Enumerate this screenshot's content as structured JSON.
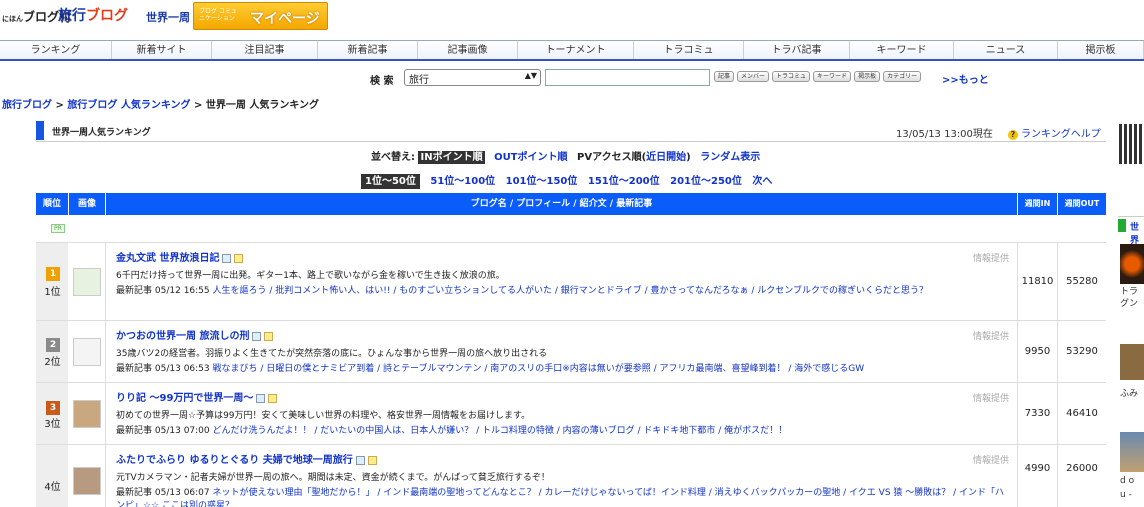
{
  "header": {
    "logo_mura": "ブログ村",
    "logo_mura_small": "にほん",
    "logo_travel_a": "旅行",
    "logo_travel_b": "ブログ",
    "logo_world": "世界一周",
    "mypage_sub": "ブログ コミュニケーション",
    "mypage_label": "マイページ"
  },
  "nav": {
    "items": [
      "ランキング",
      "新着サイト",
      "注目記事",
      "新着記事",
      "記事画像",
      "トーナメント",
      "トラコミュ",
      "トラバ記事",
      "キーワード",
      "ニュース",
      "掲示板"
    ]
  },
  "search": {
    "label": "検 索",
    "select_value": "旅行",
    "buttons": [
      "記事",
      "メンバー",
      "トラコミュ",
      "キーワード",
      "掲示板",
      "カテゴリー"
    ],
    "more": ">>もっと"
  },
  "breadcrumb": {
    "a": "旅行ブログ",
    "sep1": " > ",
    "b": "旅行ブログ 人気ランキング",
    "sep2": " > ",
    "c": "世界一周 人気ランキング"
  },
  "ranking": {
    "title": "世界一周人気ランキング",
    "datetime": "13/05/13 13:00現在",
    "help": "ランキングヘルプ",
    "sort_label": "並べ替え:",
    "sort_selected": "INポイント順",
    "sort_out": "OUTポイント順",
    "sort_pv": "PVアクセス順(",
    "sort_pv_link": "近日開始",
    "sort_pv_end": ")",
    "sort_random": "ランダム表示",
    "pages": [
      "1位〜50位",
      "51位〜100位",
      "101位〜150位",
      "151位〜200位",
      "201位〜250位",
      "次へ"
    ],
    "col_rank": "順位",
    "col_img": "画像",
    "col_main": "ブログ名 / プロフィール  / 紹介文 / 最新記事",
    "col_in": "週間IN",
    "col_out": "週間OUT",
    "pr": "PR",
    "info_label": "情報提供",
    "latest_label": "最新記事",
    "rows": [
      {
        "rank": "1位",
        "medal": "1",
        "medal_color": "#f0a000",
        "name": "金丸文武 世界放浪日記",
        "desc": "6千円だけ持って世界一周に出発。ギター1本、路上で歌いながら金を稼いで生き抜く放浪の旅。",
        "date": "05/12 16:55",
        "news": "人生を謳ろう / 批判コメント怖い人、はい!! / ものすごい立ちションしてる人がいた / 銀行マンとドライブ / 豊かさってなんだろなぁ / ルクセンブルクでの稼ぎいくらだと思う？",
        "in": "11810",
        "out": "55280"
      },
      {
        "rank": "2位",
        "medal": "2",
        "medal_color": "#8a8a8a",
        "name": "かつおの世界一周 旅流しの刑",
        "desc": "35歳バツ2の経営者。羽振りよく生きてたが突然奈落の底に。ひょんな事から世界一周の旅へ放り出される",
        "date": "05/13 06:53",
        "news": "戦なまびち / 日曜日の僕とナミビア到着 / 詩とテーブルマウンテン / 南アのスリの手口※内容は無いが要参照 / アフリカ最南端、喜望峰到着！ / 海外で感じるGW",
        "in": "9950",
        "out": "53290"
      },
      {
        "rank": "3位",
        "medal": "3",
        "medal_color": "#c85a1a",
        "name": "りり記 〜99万円で世界一周〜",
        "desc": "初めての世界一周☆予算は99万円！安くて美味しい世界の料理や、格安世界一周情報をお届けします。",
        "date": "05/13 07:00",
        "news": "どんだけ洗うんだよ！！ / だいたいの中国人は、日本人が嫌い？ / トルコ料理の特徴 / 内容の薄いブログ / ドキドキ地下都市 / 俺がボスだ！！",
        "in": "7330",
        "out": "46410"
      },
      {
        "rank": "4位",
        "medal": "",
        "medal_color": "",
        "name": "ふたりでふらり ゆるりとぐるり 夫婦で地球一周旅行",
        "desc": "元TVカメラマン・記者夫婦が世界一周の旅へ。期間は未定、資金が続くまで。がんばって貧乏旅行するぞ！",
        "date": "05/13 06:07",
        "news": "ネットが使えない理由「聖地だから！」 / インド最南端の聖地ってどんなとこ？ / カレーだけじゃないってば！インド料理 / 消えゆくバックパッカーの聖地 / イクエ VS 猿 〜勝敗は？ / インド「ハンピ」☆☆ ここは別の惑星？",
        "in": "4990",
        "out": "26000"
      }
    ]
  },
  "sidebar": {
    "title": "世界",
    "text1": "トラ",
    "text2": "グン",
    "text3": "ふみ",
    "text4": "d o",
    "text5": "u -"
  }
}
